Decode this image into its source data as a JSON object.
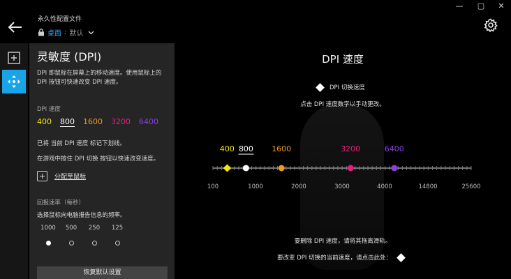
{
  "header": {
    "profile_title": "永久性配置文件",
    "profile_location": "桌面",
    "profile_separator": ":",
    "profile_value": "默认",
    "window_controls": [
      "—",
      "▢",
      "✕"
    ]
  },
  "rail": {
    "items": [
      {
        "icon": "add-square-icon",
        "selected": false
      },
      {
        "icon": "move-arrows-icon",
        "selected": true
      }
    ]
  },
  "panel": {
    "title": "灵敏度 (DPI)",
    "description": "DPI 即鼠标在屏幕上的移动速度。使用鼠标上的 DPI 按钮可快速改变 DPI 速度。",
    "dpi_speed_label": "DPI 速度",
    "presets": [
      {
        "value": "400",
        "color": "#f5e50a"
      },
      {
        "value": "800",
        "color": "#ffffff",
        "selected": true
      },
      {
        "value": "1600",
        "color": "#f09a1e"
      },
      {
        "value": "3200",
        "color": "#e3207d"
      },
      {
        "value": "6400",
        "color": "#8a3fe0"
      }
    ],
    "current_note": "已将 当前 DPI 速度 标记下划线。",
    "game_note": "在游戏中按住 DPI 切换 按钮以快速改变速度。",
    "assign_label": "分配至鼠标",
    "report_rate_label": "回报速率（每秒）",
    "report_rate_desc": "选择鼠标向电脑报告信息的频率。",
    "report_rates": [
      {
        "value": "1000",
        "selected": true
      },
      {
        "value": "500",
        "selected": false
      },
      {
        "value": "250",
        "selected": false
      },
      {
        "value": "125",
        "selected": false
      }
    ],
    "reset_label": "恢复默认设置"
  },
  "main": {
    "title": "DPI 速度",
    "legend_label": "DPI 切换速度",
    "hint_click": "点击 DPI 速度数字以手动更改。",
    "hint_delete": "要删除 DPI 速度，请将其拖离滑轨。",
    "hint_change": "要改变 DPI 切换的当前速度，请点击此处："
  },
  "slider": {
    "min": 100,
    "max": 25600,
    "axis_ticks": [
      "100",
      "1000",
      "2000",
      "3000",
      "4000",
      "14800",
      "25600"
    ],
    "markers": [
      {
        "label": "400",
        "color": "#f5e50a",
        "shape": "diamond"
      },
      {
        "label": "800",
        "color": "#ffffff",
        "shape": "circle",
        "current": true
      },
      {
        "label": "1600",
        "color": "#f09a1e",
        "shape": "circle"
      },
      {
        "label": "3200",
        "color": "#e3207d",
        "shape": "circle"
      },
      {
        "label": "6400",
        "color": "#8a3fe0",
        "shape": "circle"
      }
    ]
  }
}
